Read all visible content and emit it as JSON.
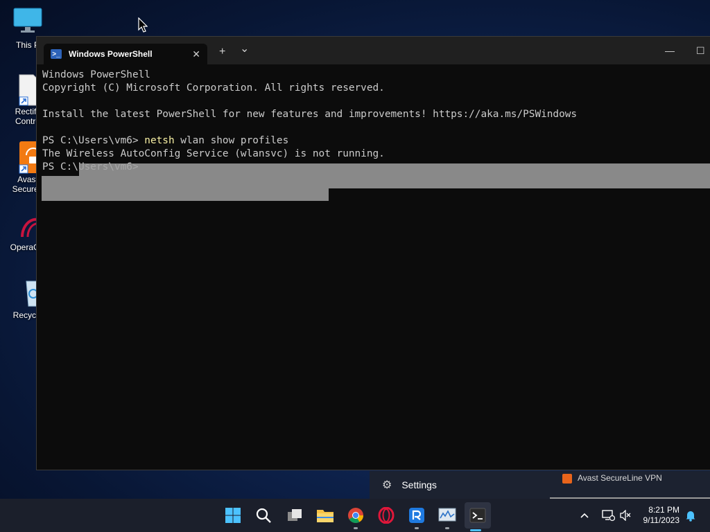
{
  "desktop": {
    "icons": [
      {
        "label": "This P"
      },
      {
        "label": "Rectify\nContro"
      },
      {
        "label": "Avast\nSecureL"
      },
      {
        "label": "OperaGX"
      },
      {
        "label": "Recycle"
      }
    ]
  },
  "terminal": {
    "tab_title": "Windows PowerShell",
    "tab_close": "✕",
    "new_tab": "+",
    "dropdown": "⌄",
    "minimize": "—",
    "maximize": "☐",
    "lines": {
      "l1": "Windows PowerShell",
      "l2": "Copyright (C) Microsoft Corporation. All rights reserved.",
      "l3": "Install the latest PowerShell for new features and improvements! https://aka.ms/PSWindows",
      "prompt1": "PS C:\\Users\\vm6> ",
      "command": "netsh",
      "command_args": " wlan show profiles",
      "l5": "The Wireless AutoConfig Service (wlansvc) is not running.",
      "prompt2": "PS C:\\Users\\vm6>"
    }
  },
  "start_menu": {
    "settings_label": "Settings",
    "vpn_label": "Avast SecureLine VPN"
  },
  "taskbar": {
    "icons": [
      "windows-start-icon",
      "search-icon",
      "task-view-icon",
      "file-explorer-icon",
      "chrome-icon",
      "opera-icon",
      "rectify-icon",
      "resource-monitor-icon",
      "terminal-icon"
    ],
    "time": "8:21 PM",
    "date": "9/11/2023"
  },
  "colors": {
    "accent": "#4cc2ff",
    "command_yellow": "#f9f1a5",
    "console_text": "#cccccc"
  }
}
